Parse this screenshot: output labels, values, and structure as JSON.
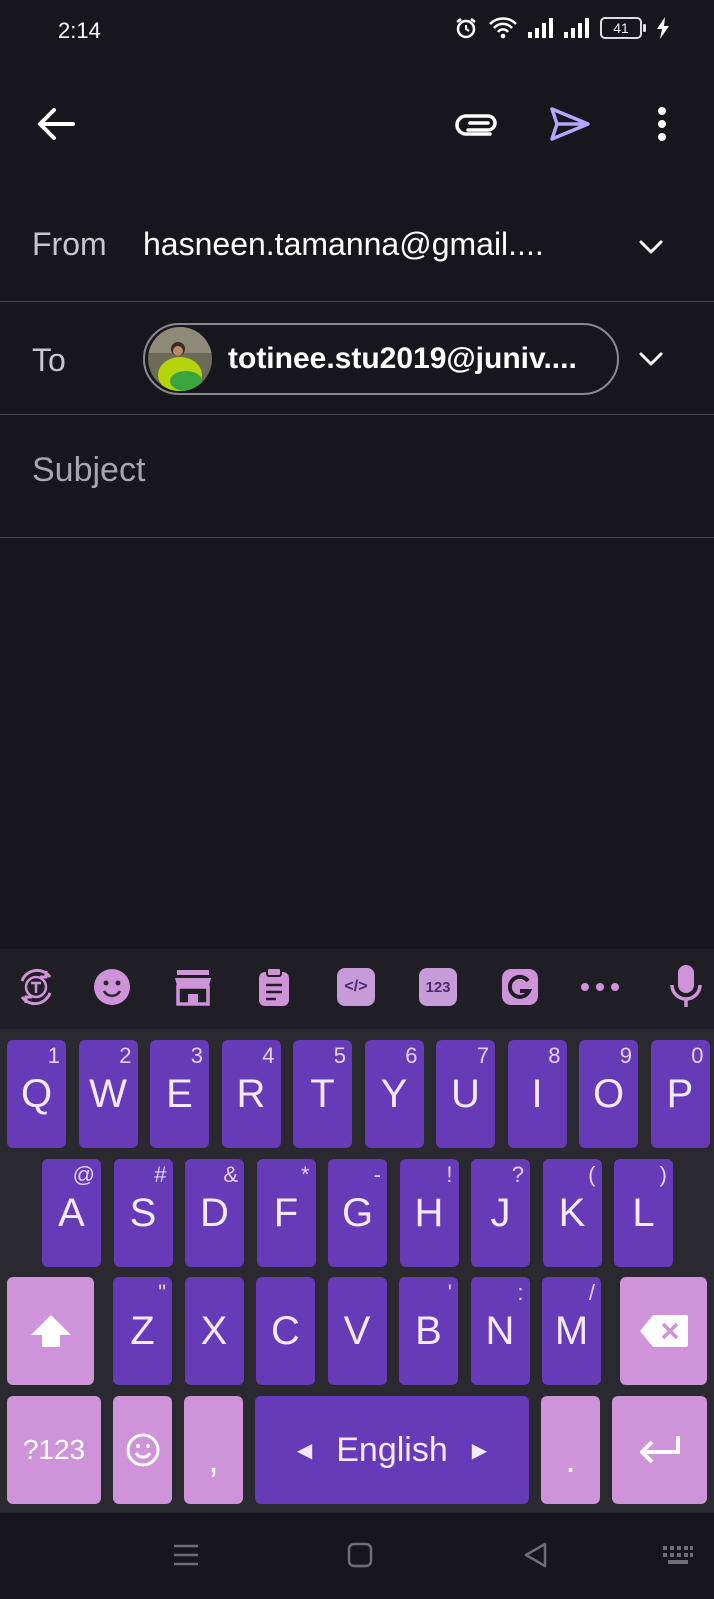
{
  "status_bar": {
    "time": "2:14",
    "battery_level": "41"
  },
  "app_bar": {
    "back_icon": "arrow-left-icon",
    "attach_icon": "paperclip-icon",
    "send_icon": "send-icon",
    "more_icon": "more-vertical-icon"
  },
  "compose": {
    "from_label": "From",
    "from_value": "hasneen.tamanna@gmail....",
    "to_label": "To",
    "to_chip": "totinee.stu2019@juniv....",
    "subject_placeholder": "Subject"
  },
  "keyboard": {
    "toolbar_icons": [
      "translate-icon",
      "emoji-icon",
      "store-icon",
      "clipboard-icon",
      "text-edit-icon",
      "numpad-icon",
      "gif-icon",
      "more-horizontal-icon",
      "microphone-icon"
    ],
    "numpad_label": "123",
    "row1": [
      {
        "k": "Q",
        "h": "1"
      },
      {
        "k": "W",
        "h": "2"
      },
      {
        "k": "E",
        "h": "3"
      },
      {
        "k": "R",
        "h": "4"
      },
      {
        "k": "T",
        "h": "5"
      },
      {
        "k": "Y",
        "h": "6"
      },
      {
        "k": "U",
        "h": "7"
      },
      {
        "k": "I",
        "h": "8"
      },
      {
        "k": "O",
        "h": "9"
      },
      {
        "k": "P",
        "h": "0"
      }
    ],
    "row2": [
      {
        "k": "A",
        "h": "@"
      },
      {
        "k": "S",
        "h": "#"
      },
      {
        "k": "D",
        "h": "&"
      },
      {
        "k": "F",
        "h": "*"
      },
      {
        "k": "G",
        "h": "-"
      },
      {
        "k": "H",
        "h": "!"
      },
      {
        "k": "J",
        "h": "?"
      },
      {
        "k": "K",
        "h": "("
      },
      {
        "k": "L",
        "h": ")"
      }
    ],
    "row3": [
      {
        "k": "Z",
        "h": "\""
      },
      {
        "k": "X",
        "h": ""
      },
      {
        "k": "C",
        "h": ""
      },
      {
        "k": "V",
        "h": ""
      },
      {
        "k": "B",
        "h": "'"
      },
      {
        "k": "N",
        "h": ":"
      },
      {
        "k": "M",
        "h": "/"
      }
    ],
    "symbols_label": "?123",
    "comma_label": ",",
    "space_label": "English",
    "period_label": ".",
    "colors": {
      "key": "#673ab7",
      "special_key": "#ce93d8",
      "background": "#2a2930"
    }
  },
  "nav_bar": {
    "icons": [
      "menu-icon",
      "home-icon",
      "back-triangle-icon",
      "keyboard-icon"
    ]
  }
}
